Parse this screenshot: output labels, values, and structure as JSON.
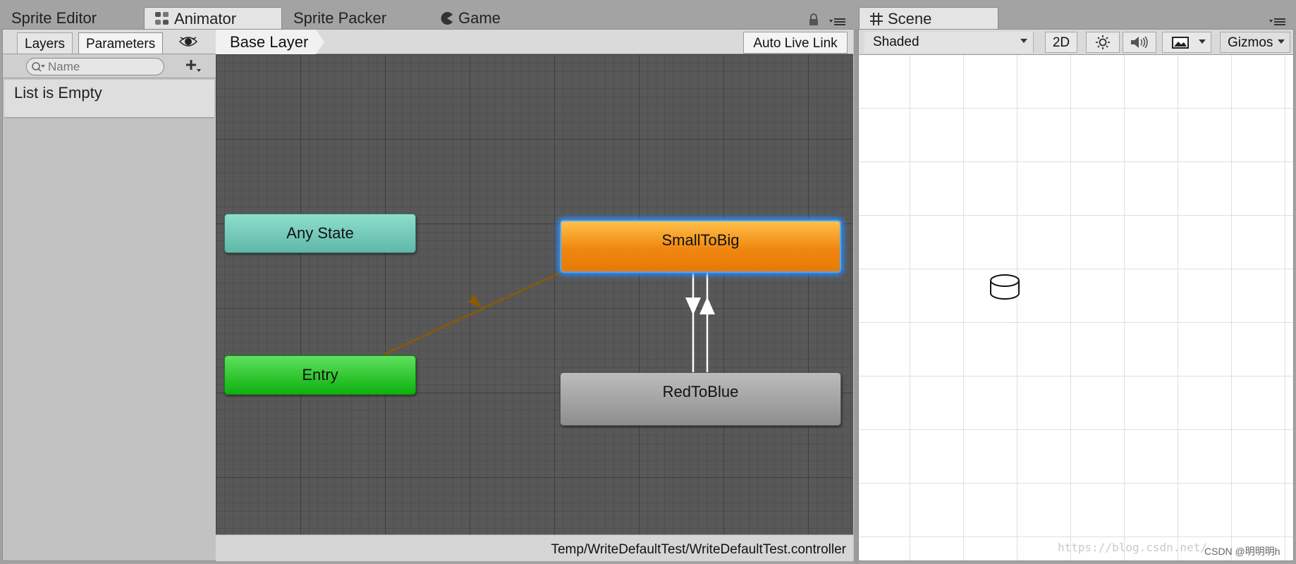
{
  "tabs": {
    "sprite_editor": "Sprite Editor",
    "animator": "Animator",
    "sprite_packer": "Sprite Packer",
    "game": "Game",
    "scene": "Scene"
  },
  "animator": {
    "subtabs": {
      "layers": "Layers",
      "parameters": "Parameters"
    },
    "search": {
      "placeholder": "Name"
    },
    "empty_message": "List is Empty",
    "breadcrumb": "Base Layer",
    "auto_live_link": "Auto Live Link",
    "states": {
      "any_state": "Any State",
      "entry": "Entry",
      "small_to_big": "SmallToBig",
      "red_to_blue": "RedToBlue"
    },
    "controller_path": "Temp/WriteDefaultTest/WriteDefaultTest.controller"
  },
  "scene": {
    "shading": "Shaded",
    "mode_2d": "2D",
    "gizmos": "Gizmos"
  },
  "watermark": {
    "url": "https://blog.csdn.net/",
    "author": "CSDN @明明明h"
  },
  "colors": {
    "any_state": "#6ccab9",
    "entry": "#2fc82f",
    "default_state": "#f08710",
    "selected_glow": "#2a8cff",
    "transition_default": "#8a5a00",
    "transition": "#ffffff"
  }
}
